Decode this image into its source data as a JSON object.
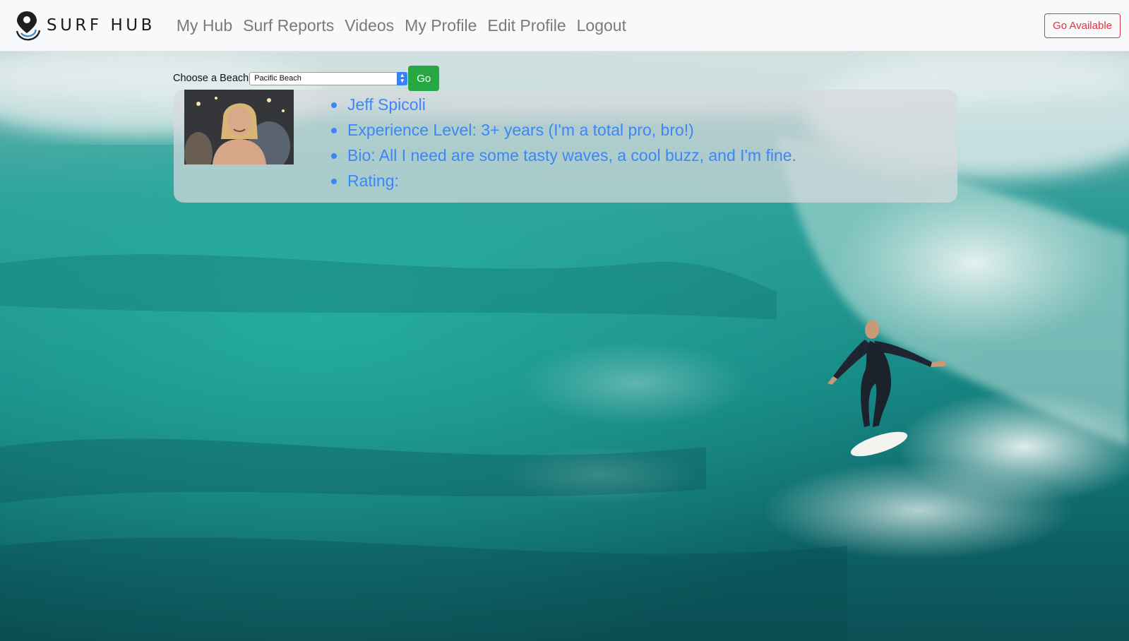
{
  "brand": {
    "name": "SURF HUB",
    "logo_icon": "map-pin-wave-icon"
  },
  "nav": {
    "links": [
      "My Hub",
      "Surf Reports",
      "Videos",
      "My Profile",
      "Edit Profile",
      "Logout"
    ],
    "go_available": "Go Available"
  },
  "beach": {
    "label": "Choose a Beach",
    "selected": "Pacific Beach",
    "go_label": "Go"
  },
  "profile": {
    "name": "Jeff Spicoli",
    "experience": "Experience Level: 3+ years (I'm a total pro, bro!)",
    "bio": "Bio: All I need are some tasty waves, a cool buzz, and I'm fine.",
    "rating": "Rating:"
  },
  "colors": {
    "nav_bg": "#f8f9fa",
    "nav_link": "#7a7a7a",
    "danger": "#dc3545",
    "success": "#28a745",
    "profile_text": "#3d86f5"
  }
}
